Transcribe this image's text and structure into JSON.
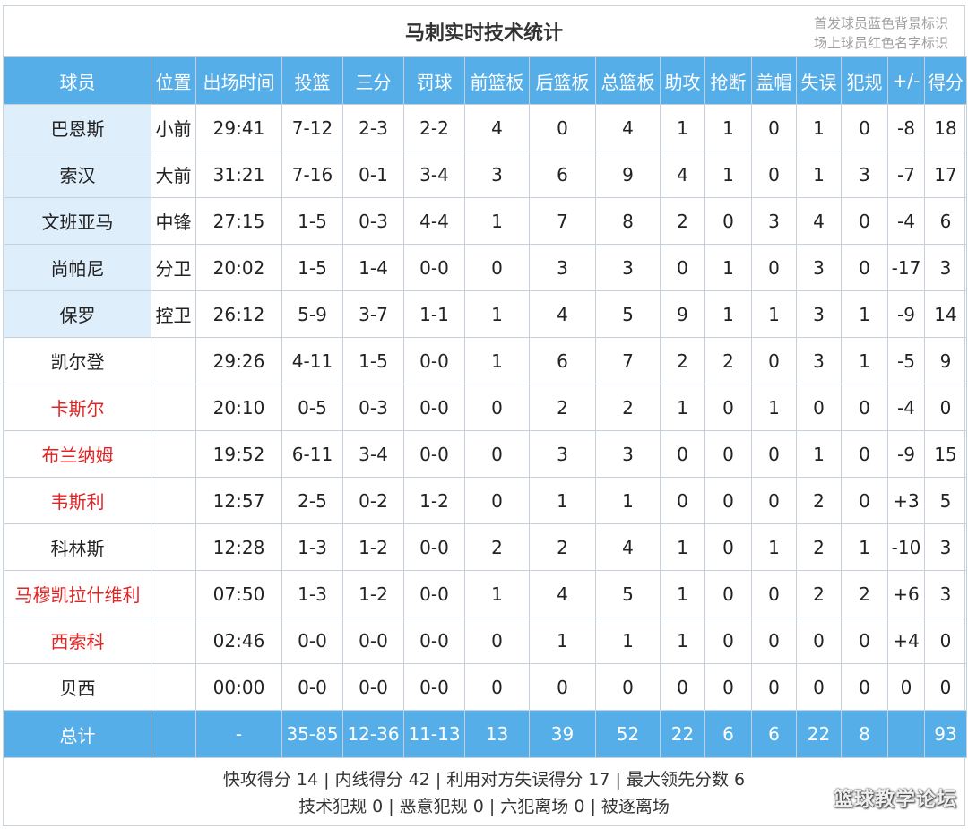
{
  "title": "马刺实时技术统计",
  "legend": {
    "line1": "首发球员蓝色背景标识",
    "line2": "场上球员红色名字标识"
  },
  "columns": [
    "球员",
    "位置",
    "出场时间",
    "投篮",
    "三分",
    "罚球",
    "前篮板",
    "后篮板",
    "总篮板",
    "助攻",
    "抢断",
    "盖帽",
    "失误",
    "犯规",
    "+/-",
    "得分"
  ],
  "players": [
    {
      "name": "巴恩斯",
      "pos": "小前",
      "min": "29:41",
      "fg": "7-12",
      "tp": "2-3",
      "ft": "2-2",
      "oreb": "4",
      "dreb": "0",
      "reb": "4",
      "ast": "1",
      "stl": "1",
      "blk": "0",
      "tov": "1",
      "pf": "0",
      "pm": "-8",
      "pts": "18",
      "starter": true,
      "oncourt": false
    },
    {
      "name": "索汉",
      "pos": "大前",
      "min": "31:21",
      "fg": "7-16",
      "tp": "0-1",
      "ft": "3-4",
      "oreb": "3",
      "dreb": "6",
      "reb": "9",
      "ast": "4",
      "stl": "1",
      "blk": "0",
      "tov": "1",
      "pf": "3",
      "pm": "-7",
      "pts": "17",
      "starter": true,
      "oncourt": false
    },
    {
      "name": "文班亚马",
      "pos": "中锋",
      "min": "27:15",
      "fg": "1-5",
      "tp": "0-3",
      "ft": "4-4",
      "oreb": "1",
      "dreb": "7",
      "reb": "8",
      "ast": "2",
      "stl": "0",
      "blk": "3",
      "tov": "4",
      "pf": "0",
      "pm": "-4",
      "pts": "6",
      "starter": true,
      "oncourt": false
    },
    {
      "name": "尚帕尼",
      "pos": "分卫",
      "min": "20:02",
      "fg": "1-5",
      "tp": "1-4",
      "ft": "0-0",
      "oreb": "0",
      "dreb": "3",
      "reb": "3",
      "ast": "0",
      "stl": "1",
      "blk": "0",
      "tov": "3",
      "pf": "0",
      "pm": "-17",
      "pts": "3",
      "starter": true,
      "oncourt": false
    },
    {
      "name": "保罗",
      "pos": "控卫",
      "min": "26:12",
      "fg": "5-9",
      "tp": "3-7",
      "ft": "1-1",
      "oreb": "1",
      "dreb": "4",
      "reb": "5",
      "ast": "9",
      "stl": "1",
      "blk": "1",
      "tov": "3",
      "pf": "1",
      "pm": "-9",
      "pts": "14",
      "starter": true,
      "oncourt": false
    },
    {
      "name": "凯尔登",
      "pos": "",
      "min": "29:26",
      "fg": "4-11",
      "tp": "1-5",
      "ft": "0-0",
      "oreb": "1",
      "dreb": "6",
      "reb": "7",
      "ast": "2",
      "stl": "2",
      "blk": "0",
      "tov": "3",
      "pf": "1",
      "pm": "-5",
      "pts": "9",
      "starter": false,
      "oncourt": false
    },
    {
      "name": "卡斯尔",
      "pos": "",
      "min": "20:10",
      "fg": "0-5",
      "tp": "0-3",
      "ft": "0-0",
      "oreb": "0",
      "dreb": "2",
      "reb": "2",
      "ast": "1",
      "stl": "0",
      "blk": "1",
      "tov": "0",
      "pf": "0",
      "pm": "-4",
      "pts": "0",
      "starter": false,
      "oncourt": true
    },
    {
      "name": "布兰纳姆",
      "pos": "",
      "min": "19:52",
      "fg": "6-11",
      "tp": "3-4",
      "ft": "0-0",
      "oreb": "0",
      "dreb": "3",
      "reb": "3",
      "ast": "0",
      "stl": "0",
      "blk": "0",
      "tov": "1",
      "pf": "0",
      "pm": "-9",
      "pts": "15",
      "starter": false,
      "oncourt": true
    },
    {
      "name": "韦斯利",
      "pos": "",
      "min": "12:57",
      "fg": "2-5",
      "tp": "0-2",
      "ft": "1-2",
      "oreb": "0",
      "dreb": "1",
      "reb": "1",
      "ast": "0",
      "stl": "0",
      "blk": "0",
      "tov": "2",
      "pf": "0",
      "pm": "+3",
      "pts": "5",
      "starter": false,
      "oncourt": true
    },
    {
      "name": "科林斯",
      "pos": "",
      "min": "12:28",
      "fg": "1-3",
      "tp": "1-2",
      "ft": "0-0",
      "oreb": "2",
      "dreb": "2",
      "reb": "4",
      "ast": "1",
      "stl": "0",
      "blk": "1",
      "tov": "2",
      "pf": "1",
      "pm": "-10",
      "pts": "3",
      "starter": false,
      "oncourt": false
    },
    {
      "name": "马穆凯拉什维利",
      "pos": "",
      "min": "07:50",
      "fg": "1-3",
      "tp": "1-2",
      "ft": "0-0",
      "oreb": "1",
      "dreb": "4",
      "reb": "5",
      "ast": "1",
      "stl": "0",
      "blk": "0",
      "tov": "2",
      "pf": "2",
      "pm": "+6",
      "pts": "3",
      "starter": false,
      "oncourt": true
    },
    {
      "name": "西索科",
      "pos": "",
      "min": "02:46",
      "fg": "0-0",
      "tp": "0-0",
      "ft": "0-0",
      "oreb": "0",
      "dreb": "1",
      "reb": "1",
      "ast": "1",
      "stl": "0",
      "blk": "0",
      "tov": "0",
      "pf": "0",
      "pm": "+4",
      "pts": "0",
      "starter": false,
      "oncourt": true
    },
    {
      "name": "贝西",
      "pos": "",
      "min": "00:00",
      "fg": "0-0",
      "tp": "0-0",
      "ft": "0-0",
      "oreb": "0",
      "dreb": "0",
      "reb": "0",
      "ast": "0",
      "stl": "0",
      "blk": "0",
      "tov": "0",
      "pf": "0",
      "pm": "0",
      "pts": "0",
      "starter": false,
      "oncourt": false
    }
  ],
  "totals": {
    "name": "总计",
    "pos": "",
    "min": "-",
    "fg": "35-85",
    "tp": "12-36",
    "ft": "11-13",
    "oreb": "13",
    "dreb": "39",
    "reb": "52",
    "ast": "22",
    "stl": "6",
    "blk": "6",
    "tov": "22",
    "pf": "8",
    "pm": "",
    "pts": "93"
  },
  "footer": {
    "line1": "快攻得分 14 | 内线得分 42 | 利用对方失误得分 17 | 最大领先分数 6",
    "line2": "技术犯规 0 | 恶意犯规 0 | 六犯离场 0 | 被逐离场"
  },
  "watermark": "篮球教学论坛",
  "colors": {
    "header_bg": "#56aee9",
    "starter_bg": "#dfeefb",
    "oncourt_text": "#e02424",
    "grid": "#c6d0da"
  }
}
